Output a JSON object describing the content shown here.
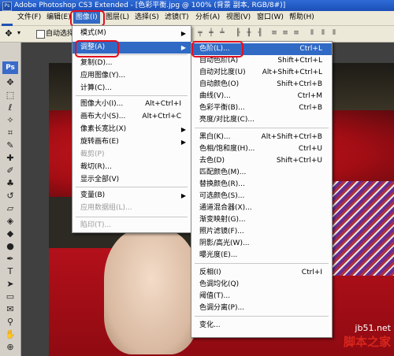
{
  "titlebar": {
    "app_icon": "Ps",
    "title": "Adobe Photoshop CS3 Extended - [色彩平衡.jpg @ 100% (背景 副本, RGB/8#)]"
  },
  "menubar": {
    "items": [
      "文件(F)",
      "编辑(E)",
      "图像(I)",
      "图层(L)",
      "选择(S)",
      "滤镜(T)",
      "分析(A)",
      "视图(V)",
      "窗口(W)",
      "帮助(H)"
    ],
    "active_index": 2
  },
  "options": {
    "auto_select_label": "自动选择"
  },
  "toolbox": {
    "badge": "Ps"
  },
  "image_menu": {
    "items": [
      {
        "label": "模式(M)",
        "shortcut": "",
        "arrow": "▶",
        "disabled": false
      },
      {
        "label": "调整(A)",
        "shortcut": "",
        "arrow": "▶",
        "disabled": false
      },
      {
        "label": "复制(D)...",
        "shortcut": "",
        "arrow": "",
        "disabled": false
      },
      {
        "label": "应用图像(Y)...",
        "shortcut": "",
        "arrow": "",
        "disabled": false
      },
      {
        "label": "计算(C)...",
        "shortcut": "",
        "arrow": "",
        "disabled": false
      },
      {
        "label": "图像大小(I)...",
        "shortcut": "Alt+Ctrl+I",
        "arrow": "",
        "disabled": false
      },
      {
        "label": "画布大小(S)...",
        "shortcut": "Alt+Ctrl+C",
        "arrow": "",
        "disabled": false
      },
      {
        "label": "像素长宽比(X)",
        "shortcut": "",
        "arrow": "▶",
        "disabled": false
      },
      {
        "label": "旋转画布(E)",
        "shortcut": "",
        "arrow": "▶",
        "disabled": false
      },
      {
        "label": "裁剪(P)",
        "shortcut": "",
        "arrow": "",
        "disabled": true
      },
      {
        "label": "裁切(R)...",
        "shortcut": "",
        "arrow": "",
        "disabled": false
      },
      {
        "label": "显示全部(V)",
        "shortcut": "",
        "arrow": "",
        "disabled": false
      },
      {
        "label": "变量(B)",
        "shortcut": "",
        "arrow": "▶",
        "disabled": false
      },
      {
        "label": "应用数据组(L)...",
        "shortcut": "",
        "arrow": "",
        "disabled": true
      },
      {
        "label": "陷印(T)...",
        "shortcut": "",
        "arrow": "",
        "disabled": true
      }
    ]
  },
  "adjust_menu": {
    "items": [
      {
        "label": "色阶(L)...",
        "shortcut": "Ctrl+L"
      },
      {
        "label": "自动色阶(A)",
        "shortcut": "Shift+Ctrl+L"
      },
      {
        "label": "自动对比度(U)",
        "shortcut": "Alt+Shift+Ctrl+L"
      },
      {
        "label": "自动颜色(O)",
        "shortcut": "Shift+Ctrl+B"
      },
      {
        "label": "曲线(V)...",
        "shortcut": "Ctrl+M"
      },
      {
        "label": "色彩平衡(B)...",
        "shortcut": "Ctrl+B"
      },
      {
        "label": "亮度/对比度(C)...",
        "shortcut": ""
      },
      {
        "label": "黑白(K)...",
        "shortcut": "Alt+Shift+Ctrl+B"
      },
      {
        "label": "色相/饱和度(H)...",
        "shortcut": "Ctrl+U"
      },
      {
        "label": "去色(D)",
        "shortcut": "Shift+Ctrl+U"
      },
      {
        "label": "匹配颜色(M)...",
        "shortcut": ""
      },
      {
        "label": "替换颜色(R)...",
        "shortcut": ""
      },
      {
        "label": "可选颜色(S)...",
        "shortcut": ""
      },
      {
        "label": "通道混合器(X)...",
        "shortcut": ""
      },
      {
        "label": "渐变映射(G)...",
        "shortcut": ""
      },
      {
        "label": "照片滤镜(F)...",
        "shortcut": ""
      },
      {
        "label": "阴影/高光(W)...",
        "shortcut": ""
      },
      {
        "label": "曝光度(E)...",
        "shortcut": ""
      },
      {
        "label": "反相(I)",
        "shortcut": "Ctrl+I"
      },
      {
        "label": "色调均化(Q)",
        "shortcut": ""
      },
      {
        "label": "阈值(T)...",
        "shortcut": ""
      },
      {
        "label": "色调分离(P)...",
        "shortcut": ""
      },
      {
        "label": "变化...",
        "shortcut": ""
      }
    ]
  },
  "watermark": {
    "url": "jb51.net",
    "name": "脚本之家"
  },
  "colors": {
    "highlight": "#316ac5",
    "callout": "#e01020"
  }
}
